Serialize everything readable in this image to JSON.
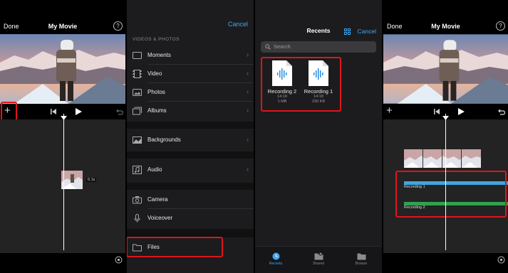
{
  "editor": {
    "done_label": "Done",
    "title": "My Movie",
    "help_symbol": "?",
    "add_symbol": "+",
    "clip_badge": "6.1s",
    "audio_tracks": [
      "Recording 1",
      "Recording 2"
    ],
    "track_colors": [
      "#3fa6e0",
      "#2fa34f"
    ],
    "highlight_color": "#e0141c"
  },
  "import_menu": {
    "cancel_label": "Cancel",
    "section_header": "VIDEOS & PHOTOS",
    "media_items": [
      {
        "label": "Moments",
        "icon": "moments-icon"
      },
      {
        "label": "Video",
        "icon": "film-icon"
      },
      {
        "label": "Photos",
        "icon": "photo-icon"
      },
      {
        "label": "Albums",
        "icon": "albums-icon"
      }
    ],
    "backgrounds_label": "Backgrounds",
    "audio_label": "Audio",
    "camera_label": "Camera",
    "voiceover_label": "Voiceover",
    "files_label": "Files"
  },
  "files_browser": {
    "title": "Recents",
    "cancel_label": "Cancel",
    "search_placeholder": "Search",
    "documents": [
      {
        "name": "Recording 2",
        "time": "14:18",
        "size": "1 MB"
      },
      {
        "name": "Recording 1",
        "time": "14:18",
        "size": "230 KB"
      }
    ],
    "tabs": [
      {
        "label": "Recents",
        "icon": "clock-icon",
        "active": true
      },
      {
        "label": "Shared",
        "icon": "shared-folder-icon",
        "active": false
      },
      {
        "label": "Browse",
        "icon": "folder-icon",
        "active": false
      }
    ],
    "accent_color": "#3fa9f5"
  }
}
